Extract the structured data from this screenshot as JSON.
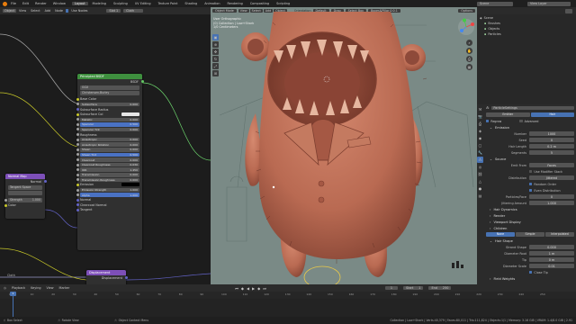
{
  "topbar": {
    "menus": [
      "File",
      "Edit",
      "Render",
      "Window",
      "Help"
    ],
    "workspaces": [
      "Layout",
      "Modeling",
      "Sculpting",
      "UV Editing",
      "Texture Paint",
      "Shading",
      "Animation",
      "Rendering",
      "Compositing",
      "Scripting"
    ],
    "active_workspace": "Layout",
    "scene_label": "Scene",
    "view_layer_label": "View Layer"
  },
  "node_editor": {
    "header": {
      "editor": "Object",
      "menus": [
        "View",
        "Select",
        "Add",
        "Node"
      ],
      "use_nodes": "Use Nodes",
      "slot": "Slot 1",
      "material": "Cloth"
    },
    "principled": {
      "title": "Principled BSDF",
      "output": "BSDF",
      "distribution": "GGX",
      "subsurface_method": "Christensen-Burley",
      "rows": [
        {
          "label": "Base Color",
          "value": ""
        },
        {
          "label": "Subsurface",
          "value": "0.000"
        },
        {
          "label": "Subsurface Radius",
          "value": ""
        },
        {
          "label": "Subsurface Col",
          "value": ""
        },
        {
          "label": "Metallic",
          "value": "0.000"
        },
        {
          "label": "Specular",
          "value": "0.500"
        },
        {
          "label": "Specular Tint",
          "value": "0.000"
        },
        {
          "label": "Roughness",
          "value": ""
        },
        {
          "label": "Anisotropic",
          "value": "0.000"
        },
        {
          "label": "Anisotropic Rotation",
          "value": "0.000"
        },
        {
          "label": "Sheen",
          "value": "0.000"
        },
        {
          "label": "Sheen Tint",
          "value": "0.500"
        },
        {
          "label": "Clearcoat",
          "value": "0.000"
        },
        {
          "label": "Clearcoat Roughness",
          "value": "0.030"
        },
        {
          "label": "IOR",
          "value": "1.450"
        },
        {
          "label": "Transmission",
          "value": "0.000"
        },
        {
          "label": "Transmission Roughness",
          "value": "0.000"
        },
        {
          "label": "Emission",
          "value": ""
        },
        {
          "label": "Emission Strength",
          "value": "1.000"
        },
        {
          "label": "Alpha",
          "value": "1.000"
        },
        {
          "label": "Normal",
          "value": ""
        },
        {
          "label": "Clearcoat Normal",
          "value": ""
        },
        {
          "label": "Tangent",
          "value": ""
        }
      ]
    },
    "normal_map": {
      "title": "Normal Map",
      "output": "Normal",
      "space": "Tangent Space",
      "uv": "",
      "strength_label": "Strength",
      "strength": "1.000",
      "color_label": "Color"
    },
    "displacement": {
      "title": "Displacement",
      "output": "Displacement"
    },
    "cloth_label": "Cloth"
  },
  "viewport": {
    "header": {
      "mode": "Object Mode",
      "menus": [
        "View",
        "Select",
        "Add",
        "Object"
      ],
      "orientation": "Orientation",
      "global": "Default",
      "drag": "Drag",
      "select_box": "Select Box",
      "brush": "Boxes&Pillar 0.0.1"
    },
    "info": [
      "User Orthographic",
      "(0) Collection | Low+Shark",
      "1/0 Centimeters"
    ],
    "options_label": "Options"
  },
  "outliner": {
    "items": [
      "Scene",
      "Brushes",
      "Objects",
      "Particles"
    ]
  },
  "properties": {
    "header_label": "ParticleSettings",
    "tabs": [
      "Emitter",
      "Hair"
    ],
    "active_tab": "Hair",
    "regrow_label": "Regrow",
    "advanced_label": "Advanced",
    "emission": {
      "title": "Emission",
      "rows": [
        {
          "label": "Number",
          "value": "1000"
        },
        {
          "label": "Seed",
          "value": "0"
        },
        {
          "label": "Hair Length",
          "value": "0.2 m"
        },
        {
          "label": "Segments",
          "value": "5"
        }
      ]
    },
    "source": {
      "title": "Source",
      "emit_from_label": "Emit From",
      "emit_from": "Faces",
      "use_modifier_stack": "Use Modifier Stack",
      "distribution_label": "Distribution",
      "distribution": "Jittered",
      "random_order": "Random Order",
      "even_distribution": "Even Distribution",
      "particles_face_label": "Particles/Face",
      "particles_face": "0",
      "jittering_label": "Jittering Amount",
      "jittering": "1.000"
    },
    "collapsed": [
      "Hair Dynamics",
      "Render",
      "Viewport Display",
      "Children"
    ],
    "children_tabs": [
      "None",
      "Simple",
      "Interpolated"
    ],
    "active_child_tab": "None",
    "hair_shape": {
      "title": "Hair Shape",
      "rows": [
        {
          "label": "Strand Shape",
          "value": "0.000"
        },
        {
          "label": "Diameter Root",
          "value": "1 m"
        },
        {
          "label": "Tip",
          "value": "0 m"
        },
        {
          "label": "Diameter Scale",
          "value": "0.01"
        }
      ],
      "close_tip": "Close Tip"
    },
    "field_weights": "Field Weights"
  },
  "timeline": {
    "menus": [
      "Playback",
      "Keying",
      "View",
      "Marker"
    ],
    "start_label": "Start",
    "start": "1",
    "end_label": "End",
    "end": "250",
    "current": "1",
    "ticks": [
      "0",
      "10",
      "20",
      "30",
      "40",
      "50",
      "60",
      "70",
      "80",
      "90",
      "100",
      "110",
      "120",
      "130",
      "140",
      "150",
      "160",
      "170",
      "180",
      "190",
      "200",
      "210",
      "220",
      "230",
      "240",
      "250"
    ]
  },
  "statusbar": {
    "left": [
      "Box Select",
      "Rotate View",
      "Object Context Menu"
    ],
    "stats": "Collection | Low+Shark | Verts:40,379 | Faces:80,011 | Tris:111,824 | Objects:1/1 | Memory: 3.16 GiB | VRAM: 1.4/8.0 GiB | 2.91"
  },
  "colors": {
    "accent": "#4772b3",
    "node_header_green": "#3e8f3e",
    "node_header_purple": "#7d4fb8",
    "character": "#b96a52",
    "viewport_bg": "#7a8a86"
  }
}
